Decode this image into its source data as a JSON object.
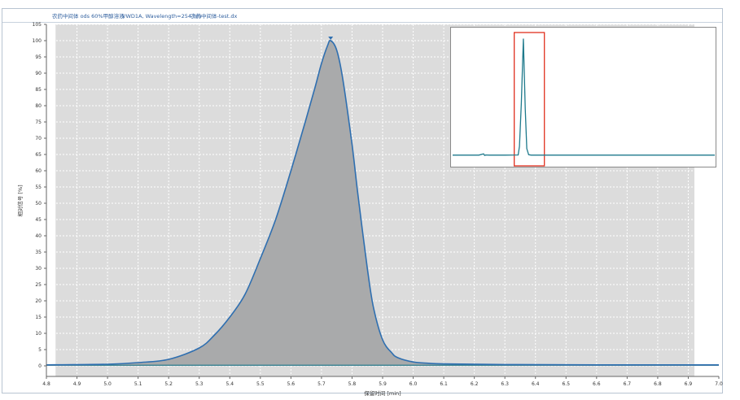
{
  "header": {
    "sample_name": "农药中间体 ods 60%甲醇溶液",
    "detector_info": "VWD1A, Wavelength=254 nm",
    "file_name": "农药中间体-test.dx"
  },
  "chart_data": {
    "type": "area",
    "xlabel": "保留时间 [min]",
    "ylabel": "相对信号 [%]",
    "xlim": [
      4.8,
      7.0
    ],
    "ylim": [
      0,
      105
    ],
    "x_ticks": [
      4.8,
      4.9,
      5.0,
      5.1,
      5.2,
      5.3,
      5.4,
      5.5,
      5.6,
      5.7,
      5.8,
      5.9,
      6.0,
      6.1,
      6.2,
      6.3,
      6.4,
      6.5,
      6.6,
      6.7,
      6.8,
      6.9,
      7.0
    ],
    "y_ticks": [
      0,
      5,
      10,
      15,
      20,
      25,
      30,
      35,
      40,
      45,
      50,
      55,
      60,
      65,
      70,
      75,
      80,
      85,
      90,
      95,
      100,
      105
    ],
    "integration_window": [
      4.83,
      6.92
    ],
    "baseline": 0.2,
    "grid": true,
    "series": [
      {
        "x": [
          4.8,
          5.0,
          5.1,
          5.2,
          5.3,
          5.35,
          5.4,
          5.45,
          5.5,
          5.55,
          5.6,
          5.65,
          5.68,
          5.7,
          5.72,
          5.73,
          5.75,
          5.77,
          5.8,
          5.82,
          5.85,
          5.87,
          5.9,
          5.93,
          5.95,
          6.0,
          6.05,
          6.1,
          6.3,
          6.6,
          7.0
        ],
        "y": [
          0.3,
          0.5,
          1.0,
          2.0,
          5.5,
          9.5,
          15.0,
          22.0,
          33.0,
          45.0,
          60.0,
          76.0,
          86.0,
          93.0,
          98.5,
          100.0,
          97.0,
          88.0,
          68.0,
          52.0,
          30.0,
          18.0,
          8.0,
          4.0,
          2.5,
          1.2,
          0.8,
          0.6,
          0.4,
          0.3,
          0.3
        ]
      }
    ],
    "peak": {
      "x": 5.73,
      "y": 100
    },
    "inset": {
      "type": "line",
      "description_free": true,
      "x": [
        0.0,
        0.1,
        0.118,
        0.122,
        0.126,
        0.14,
        0.2,
        0.25,
        0.255,
        0.262,
        0.27,
        0.277,
        0.283,
        0.29,
        0.3,
        0.4,
        1.0
      ],
      "y": [
        0.5,
        0.5,
        1.6,
        0.2,
        0.6,
        0.5,
        0.5,
        0.6,
        8.0,
        45.0,
        100.0,
        40.0,
        6.0,
        0.8,
        0.5,
        0.5,
        0.5
      ],
      "xlim": [
        0,
        1
      ],
      "ylim": [
        -8,
        108
      ],
      "highlight": [
        0.235,
        0.35
      ],
      "colors": {
        "line": "#1f7a8c",
        "highlight": "#e0301e"
      }
    },
    "colors": {
      "fill": "#a9aaab",
      "line": "#2f6fb0",
      "baseline": "#1f7a8c",
      "window_bg": "#dcdcdc"
    }
  }
}
